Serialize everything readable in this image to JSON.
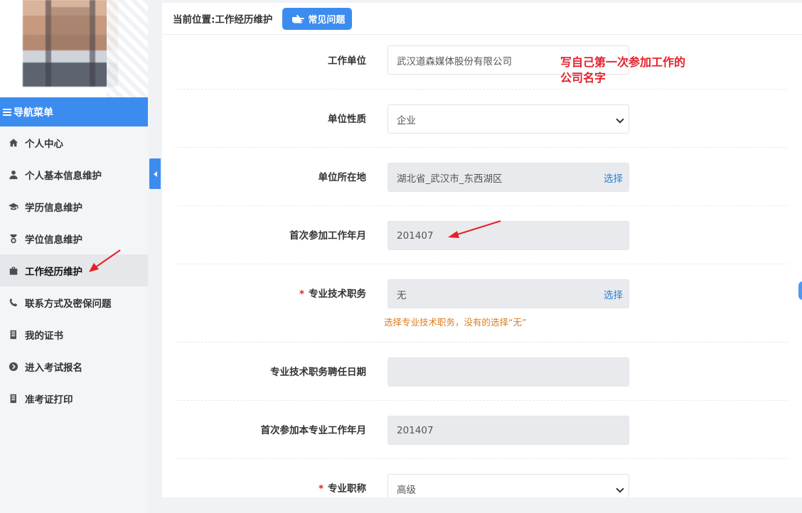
{
  "breadcrumb": {
    "prefix": "当前位置:",
    "current": "工作经历维护"
  },
  "faq_button": {
    "label": "常见问题",
    "icon": "pointing-hand-icon"
  },
  "sidebar": {
    "header": "导航菜单",
    "items": [
      {
        "label": "个人中心",
        "icon": "home-icon"
      },
      {
        "label": "个人基本信息维护",
        "icon": "user-icon"
      },
      {
        "label": "学历信息维护",
        "icon": "graduation-cap-icon"
      },
      {
        "label": "学位信息维护",
        "icon": "medal-icon"
      },
      {
        "label": "工作经历维护",
        "icon": "briefcase-icon",
        "active": true
      },
      {
        "label": "联系方式及密保问题",
        "icon": "phone-icon"
      },
      {
        "label": "我的证书",
        "icon": "book-icon"
      },
      {
        "label": "进入考试报名",
        "icon": "arrow-circle-icon"
      },
      {
        "label": "准考证打印",
        "icon": "print-book-icon"
      }
    ]
  },
  "form": {
    "company": {
      "label": "工作单位",
      "value": "武汉道森媒体股份有限公司"
    },
    "company_type": {
      "label": "单位性质",
      "value": "企业"
    },
    "location": {
      "label": "单位所在地",
      "value": "湖北省_武汉市_东西湖区",
      "action": "选择"
    },
    "first_work_month": {
      "label": "首次参加工作年月",
      "value": "201407"
    },
    "tech_title": {
      "label": "专业技术职务",
      "required": "*",
      "value": "无",
      "action": "选择",
      "hint": "选择专业技术职务，没有的选择“无”"
    },
    "appoint_date": {
      "label": "专业技术职务聘任日期",
      "value": ""
    },
    "first_prof_month": {
      "label": "首次参加本专业工作年月",
      "value": "201407"
    },
    "prof_rank": {
      "label": "专业职称",
      "required": "*",
      "value": "高级"
    }
  },
  "annotation": {
    "line1": "写自己第一次参加工作的",
    "line2": "公司名字",
    "color": "#e4212b"
  },
  "colors": {
    "accent": "#3c8cf0",
    "hint": "#e07b1a",
    "link": "#2f80d8"
  }
}
